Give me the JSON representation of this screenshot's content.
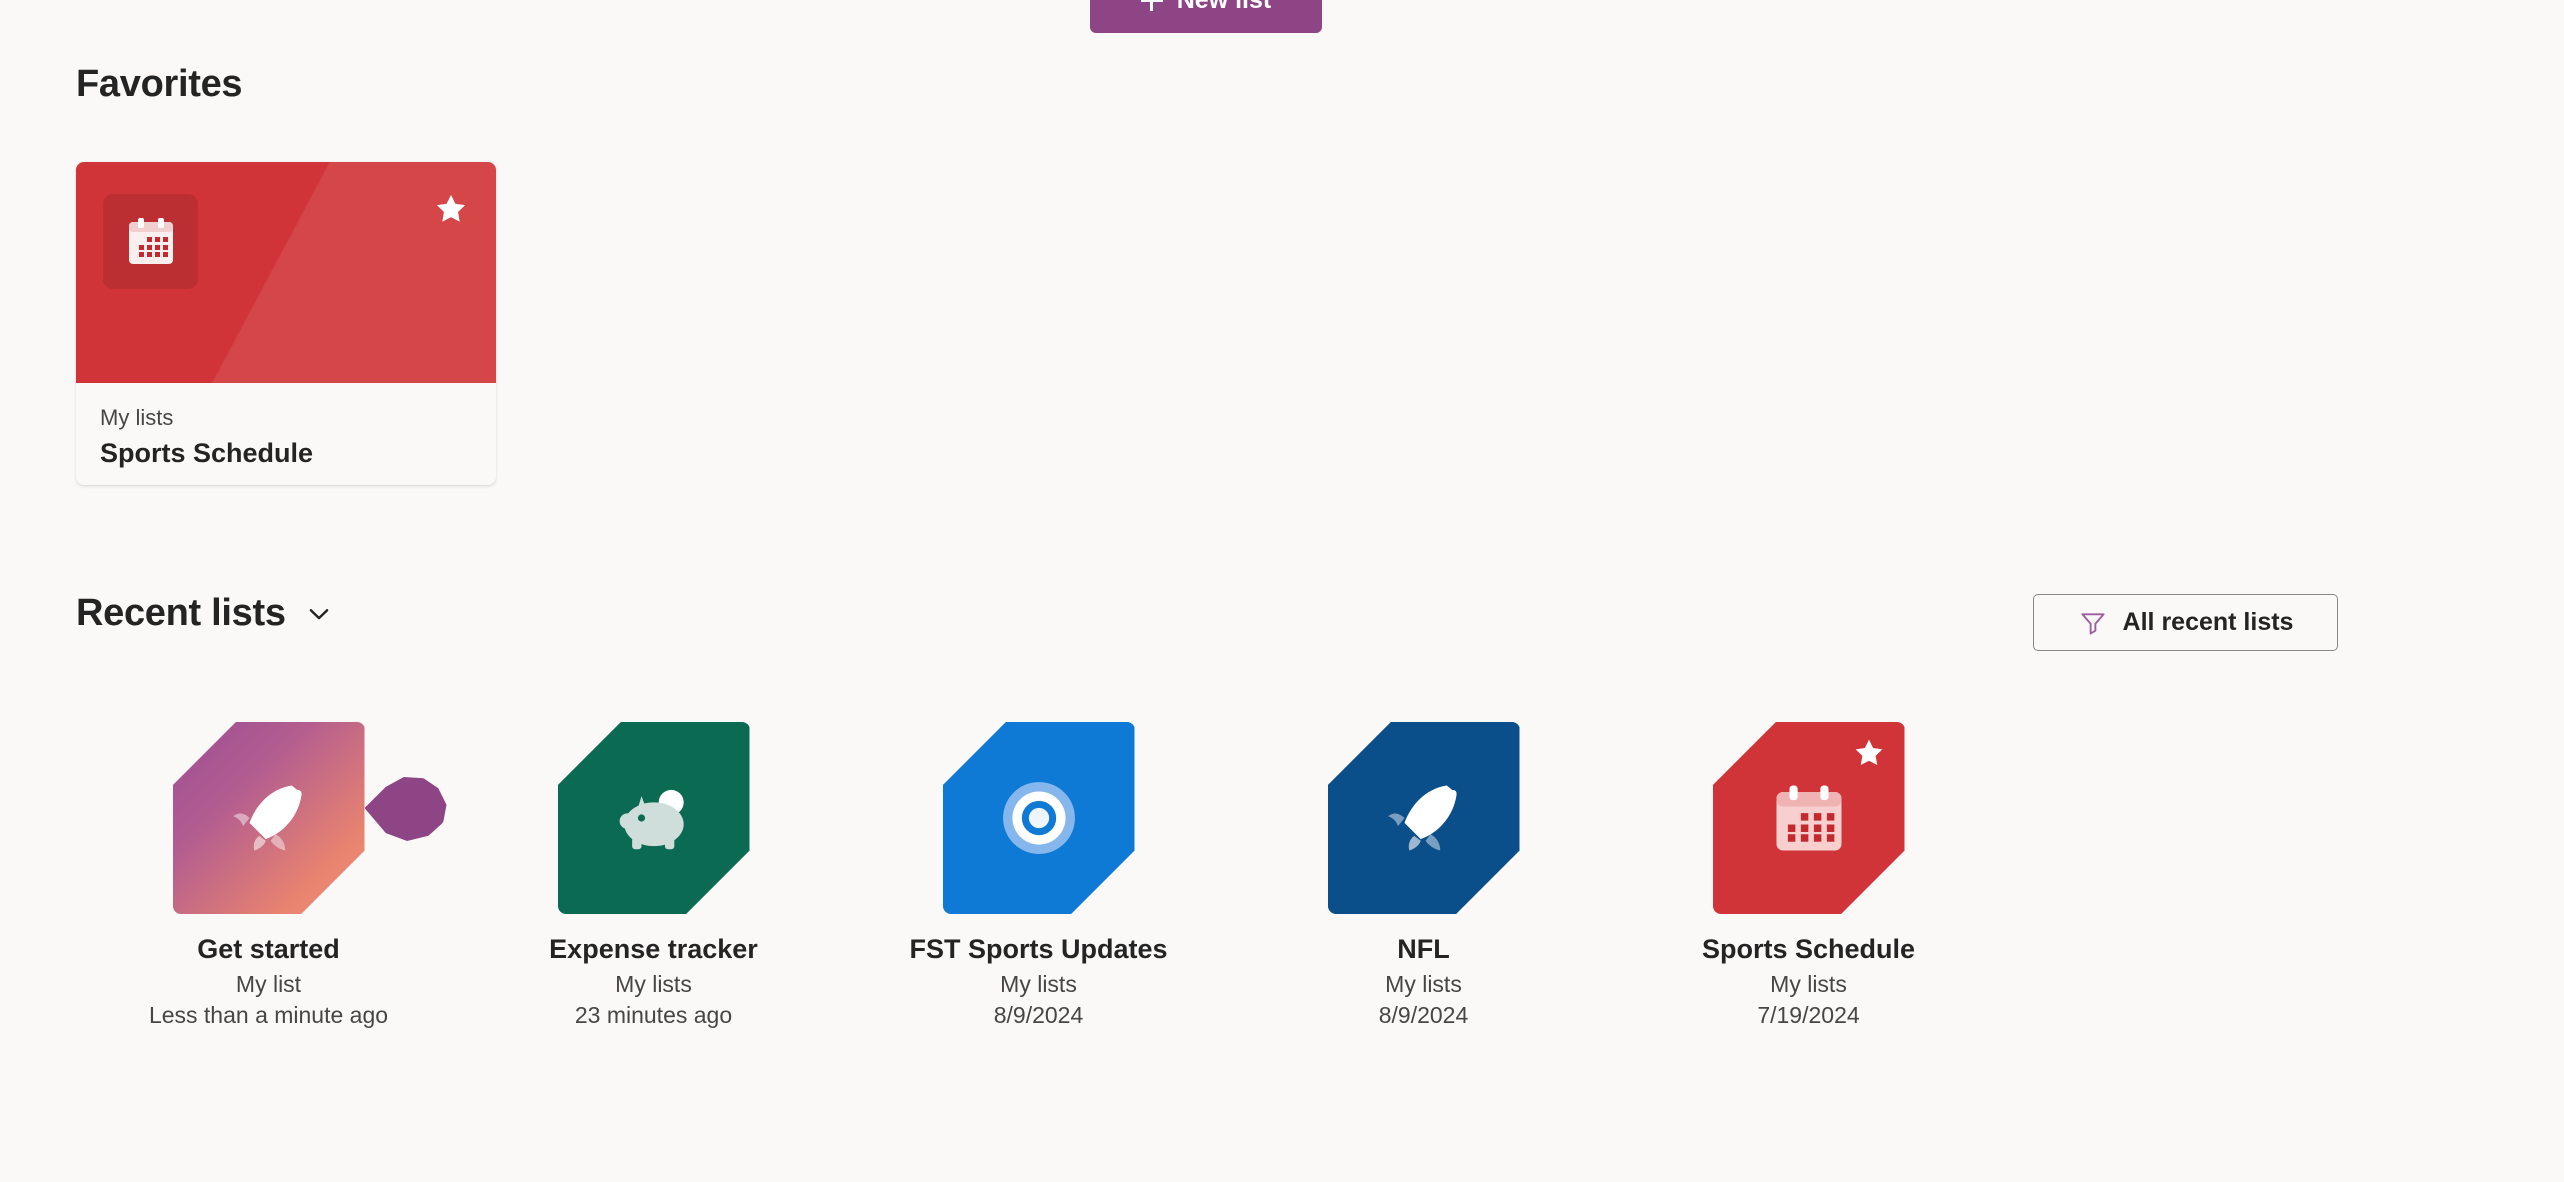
{
  "toolbar": {
    "new_list_label": "New list",
    "new_list_icon": "plus-icon",
    "new_list_color": "#8e4585"
  },
  "favorites": {
    "heading": "Favorites",
    "cards": [
      {
        "site": "My lists",
        "title": "Sports Schedule",
        "icon": "calendar-icon",
        "color": "#d13438",
        "starred": true,
        "star_icon": "star-icon"
      }
    ]
  },
  "recent": {
    "heading": "Recent lists",
    "chevron_icon": "chevron-down-icon",
    "filter_button": {
      "label": "All recent lists",
      "icon": "filter-icon",
      "icon_color": "#8e4585"
    },
    "items": [
      {
        "title": "Get started",
        "site": "My list",
        "modified": "Less than a minute ago",
        "icon": "rocket-icon",
        "color": "#a martin",
        "gradient_from": "#9b4f96",
        "gradient_to": "#f08a72",
        "starred": false,
        "callout": true
      },
      {
        "title": "Expense tracker",
        "site": "My lists",
        "modified": "23 minutes ago",
        "icon": "piggy-bank-icon",
        "gradient_from": "#0b6a52",
        "gradient_to": "#0b6a52",
        "starred": false,
        "callout": false
      },
      {
        "title": "FST Sports Updates",
        "site": "My lists",
        "modified": "8/9/2024",
        "icon": "bullseye-icon",
        "gradient_from": "#0f7ad6",
        "gradient_to": "#0f7ad6",
        "starred": false,
        "callout": false
      },
      {
        "title": "NFL",
        "site": "My lists",
        "modified": "8/9/2024",
        "icon": "rocket-icon",
        "gradient_from": "#0b4f8a",
        "gradient_to": "#0b4f8a",
        "starred": false,
        "callout": false
      },
      {
        "title": "Sports Schedule",
        "site": "My lists",
        "modified": "7/19/2024",
        "icon": "calendar-icon",
        "gradient_from": "#d13438",
        "gradient_to": "#d13438",
        "starred": true,
        "star_icon": "star-icon",
        "callout": false
      }
    ]
  }
}
